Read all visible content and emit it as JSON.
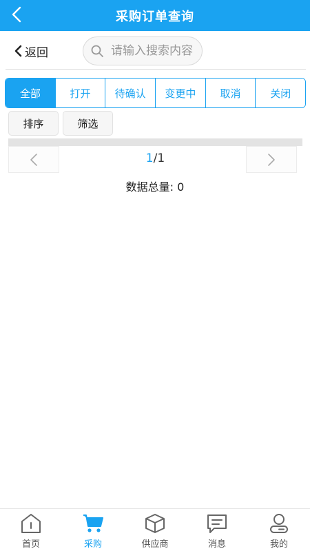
{
  "header": {
    "title": "采购订单查询"
  },
  "search_row": {
    "back_label": "返回",
    "search_placeholder": "请输入搜索内容"
  },
  "tabs": [
    {
      "label": "全部",
      "active": true
    },
    {
      "label": "打开",
      "active": false
    },
    {
      "label": "待确认",
      "active": false
    },
    {
      "label": "变更中",
      "active": false
    },
    {
      "label": "取消",
      "active": false
    },
    {
      "label": "关闭",
      "active": false
    }
  ],
  "actions": {
    "sort_label": "排序",
    "filter_label": "筛选"
  },
  "pagination": {
    "current": "1",
    "separator": "/",
    "total": "1"
  },
  "summary": {
    "total_label": "数据总量: 0"
  },
  "bottom_nav": [
    {
      "label": "首页",
      "icon": "home-icon",
      "active": false
    },
    {
      "label": "采购",
      "icon": "cart-icon",
      "active": true
    },
    {
      "label": "供应商",
      "icon": "box-icon",
      "active": false
    },
    {
      "label": "消息",
      "icon": "message-icon",
      "active": false
    },
    {
      "label": "我的",
      "icon": "user-icon",
      "active": false
    }
  ],
  "colors": {
    "primary": "#1aa3f1",
    "icon_gray": "#666666"
  }
}
